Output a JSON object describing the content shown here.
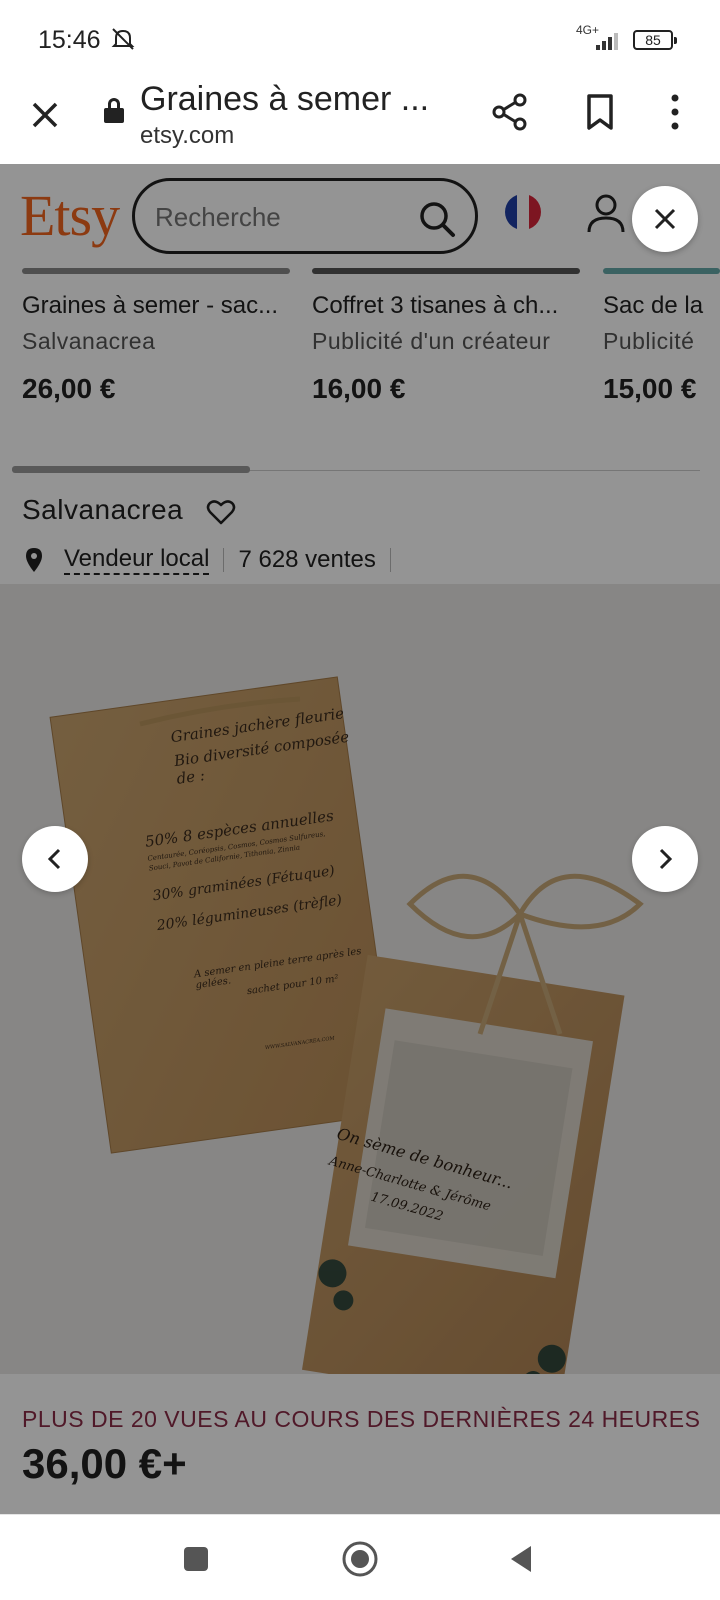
{
  "status_bar": {
    "time": "15:46",
    "network": "4G+",
    "battery": "85"
  },
  "tab": {
    "title": "Graines à semer ...",
    "url": "etsy.com"
  },
  "etsy": {
    "logo": "Etsy",
    "search_placeholder": "Recherche",
    "brand_color": "#f1641e"
  },
  "products": [
    {
      "name": "Graines à semer - sac...",
      "shop": "Salvanacrea",
      "price": "26,00 €"
    },
    {
      "name": "Coffret 3 tisanes à ch...",
      "shop": "Publicité d'un créateur",
      "price": "16,00 €"
    },
    {
      "name": "Sac de la",
      "shop": "Publicité",
      "price": "15,00 €"
    }
  ],
  "shop": {
    "name": "Salvanacrea",
    "local_label": "Vendeur local",
    "sales": "7 628 ventes"
  },
  "card_left": {
    "line1": "Graines jachère fleurie",
    "line2": "Bio diversité composée de :",
    "line3": "50% 8 espèces annuelles",
    "line4": "Centaurée, Coréopsis, Cosmos, Cosmos Sulfureus,",
    "line5": "Souci, Pavot de Californie, Tithonia, Zinnia",
    "line6": "30% graminées (Fétuque)",
    "line7": "20% légumineuses (trèfle)",
    "line8": "A semer en pleine terre après les gelées.",
    "line9": "sachet pour 10 m²",
    "line10": "WWW.SALVANACREA.COM"
  },
  "card_right": {
    "line1": "On sème de bonheur...",
    "line2": "Anne-Charlotte & Jérôme",
    "line3": "17.09.2022"
  },
  "listing": {
    "views": "PLUS DE 20 VUES AU COURS DES DERNIÈRES 24 HEURES",
    "price": "36,00 €+",
    "views_color": "#8b2c48"
  }
}
